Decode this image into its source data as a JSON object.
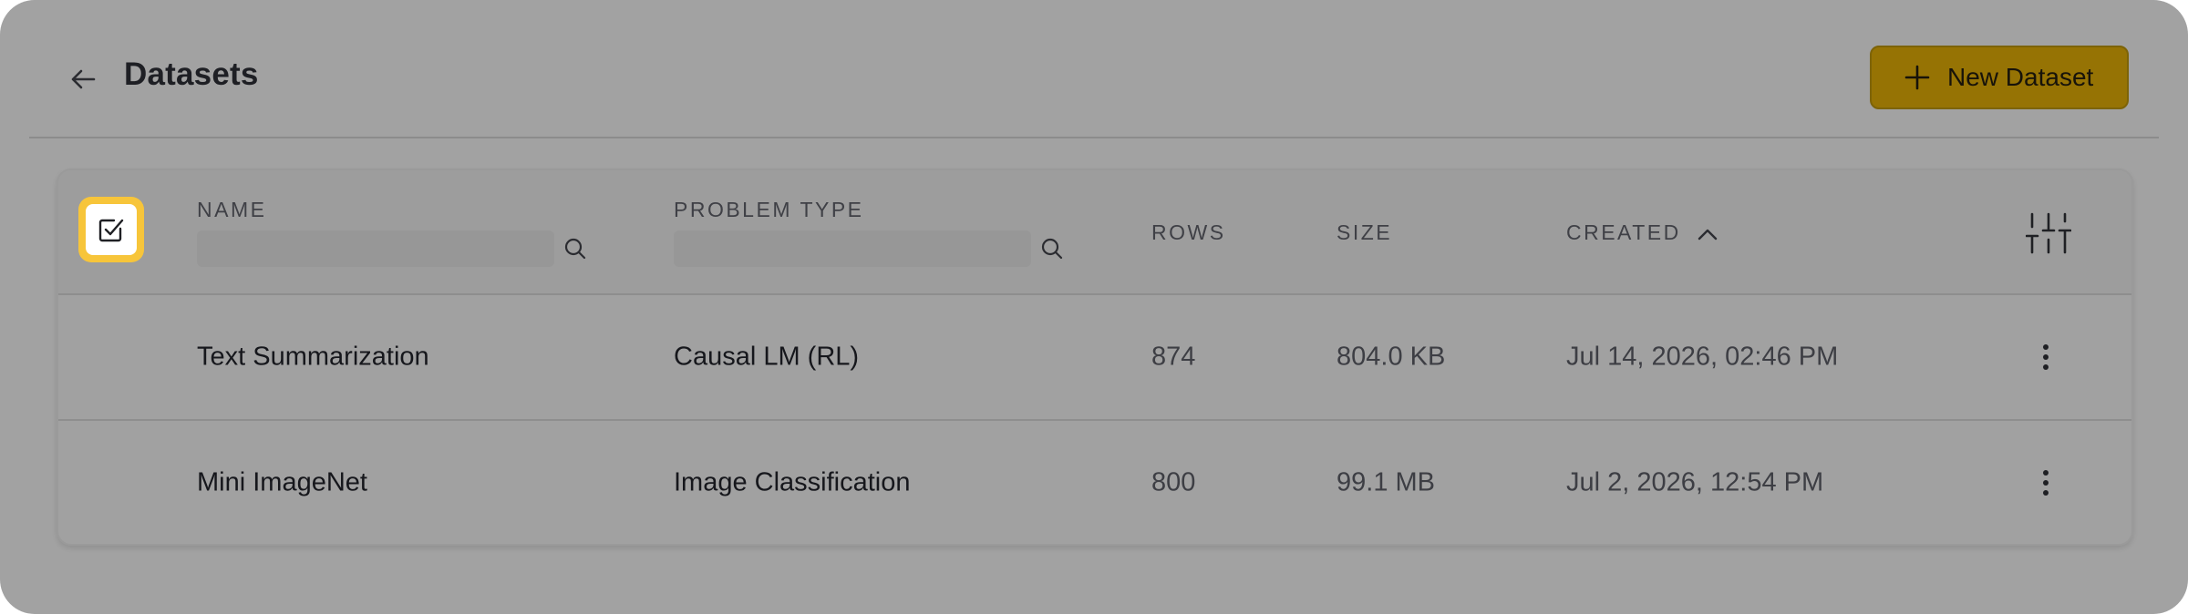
{
  "header": {
    "title": "Datasets",
    "back_icon": "arrow-left-icon",
    "new_button_label": "New Dataset",
    "new_button_icon": "plus-icon"
  },
  "table": {
    "columns": {
      "name": "NAME",
      "problem_type": "PROBLEM TYPE",
      "rows": "ROWS",
      "size": "SIZE",
      "created": "CREATED"
    },
    "filters": {
      "name_value": "",
      "problem_type_value": ""
    },
    "sort": {
      "column": "created",
      "direction": "ascending"
    },
    "rows": [
      {
        "name": "Text Summarization",
        "problem_type": "Causal LM (RL)",
        "rows": "874",
        "size": "804.0 KB",
        "created": "Jul 14, 2026, 02:46 PM"
      },
      {
        "name": "Mini ImageNet",
        "problem_type": "Image Classification",
        "rows": "800",
        "size": "99.1 MB",
        "created": "Jul 2, 2026, 12:54 PM"
      }
    ]
  },
  "colors": {
    "overlay_background": "#a2a2a2",
    "accent_button": "#967304",
    "highlight": "#f7c53a"
  }
}
